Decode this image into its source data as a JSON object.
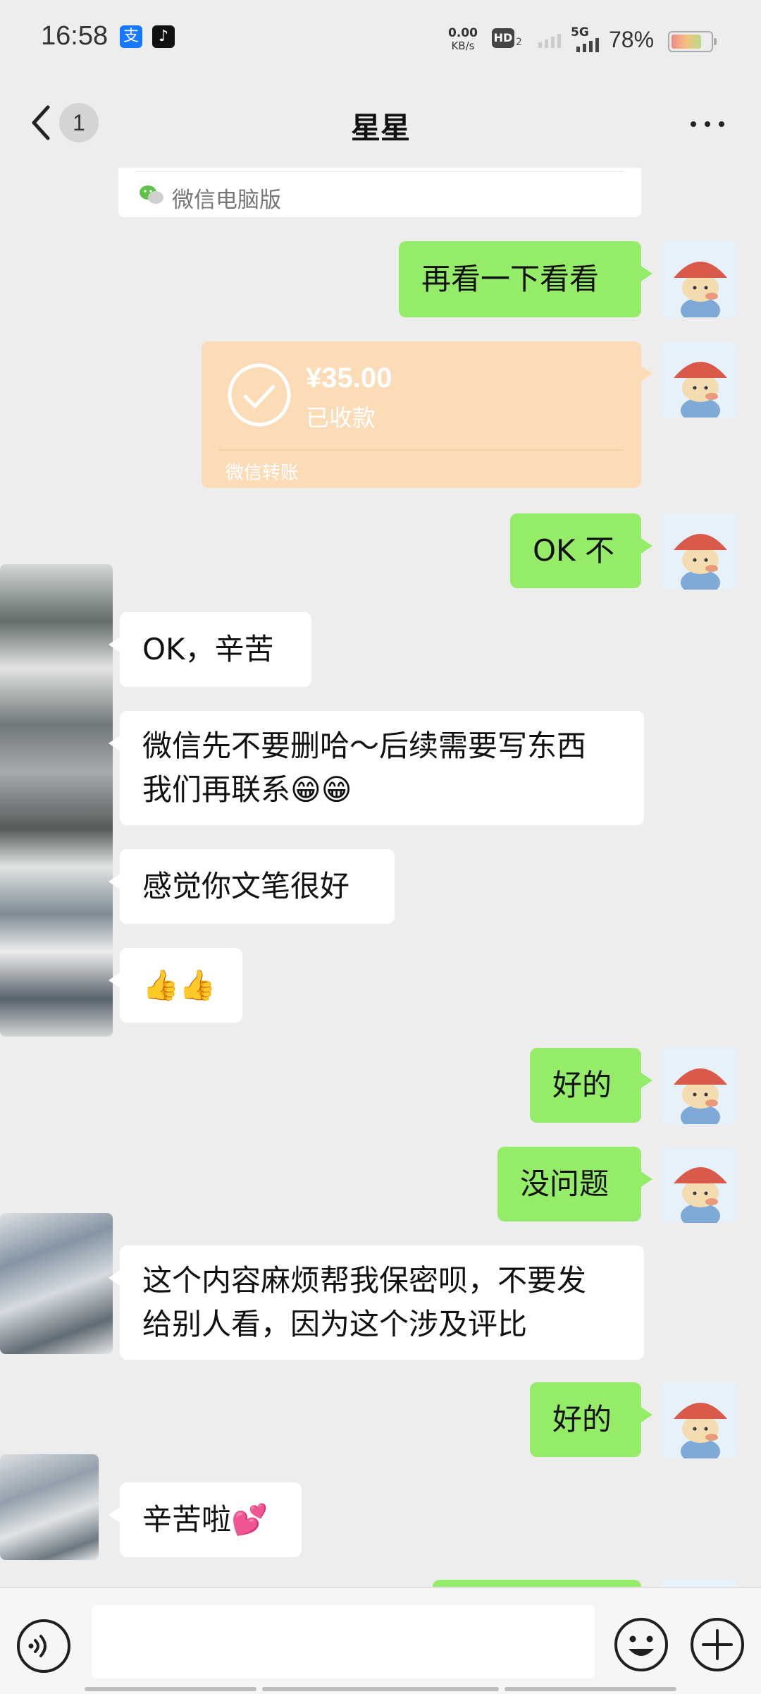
{
  "status_bar": {
    "time": "16:58",
    "net_speed_value": "0.00",
    "net_speed_unit": "KB/s",
    "hd_label": "HD",
    "hd_sub": "2",
    "network_type": "5G",
    "battery": "78%",
    "battery_level": 0.78,
    "app_icons": [
      "alipay-icon",
      "tiktok-icon"
    ]
  },
  "header": {
    "unread_count": "1",
    "title": "星星"
  },
  "messages": [
    {
      "side": "system-card",
      "text": "微信电脑版",
      "icon": "wechat-icon"
    },
    {
      "side": "right",
      "text": "再看一下看看"
    },
    {
      "side": "right",
      "type": "transfer",
      "amount": "¥35.00",
      "status": "已收款",
      "footer": "微信转账"
    },
    {
      "side": "right",
      "text": "OK 不"
    },
    {
      "side": "left",
      "text": "OK，辛苦"
    },
    {
      "side": "left",
      "text": "微信先不要删哈～后续需要写东西\n我们再联系😁😁"
    },
    {
      "side": "left",
      "text": "感觉你文笔很好"
    },
    {
      "side": "left",
      "text": "👍👍"
    },
    {
      "side": "right",
      "text": "好的"
    },
    {
      "side": "right",
      "text": "没问题"
    },
    {
      "side": "left",
      "text": "这个内容麻烦帮我保密呗，不要发\n给别人看，因为这个涉及评比"
    },
    {
      "side": "right",
      "text": "好的"
    },
    {
      "side": "left",
      "text": "辛苦啦💕"
    }
  ],
  "input_bar": {
    "voice_icon": "voice-icon",
    "emoji_icon": "emoji-icon",
    "plus_icon": "plus-icon",
    "input_value": ""
  },
  "colors": {
    "background": "#ededed",
    "sent_bubble": "#95ec69",
    "received_bubble": "#ffffff",
    "transfer_card": "#fbdcb7"
  }
}
